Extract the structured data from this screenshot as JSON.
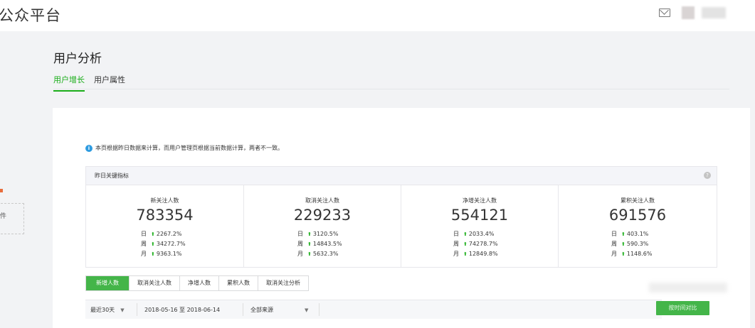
{
  "header": {
    "brand": "公众平台",
    "icons": {
      "mail": "mail-icon"
    }
  },
  "sidebar": {
    "item_fragment": "件"
  },
  "page": {
    "title": "用户分析",
    "tabs": [
      {
        "label": "用户增长",
        "active": true
      },
      {
        "label": "用户属性",
        "active": false
      }
    ]
  },
  "notice": {
    "icon": "info-icon",
    "text": "本页根据昨日数据来计算，而用户管理页根据当前数据计算，两者不一致。"
  },
  "kpi_panel": {
    "title": "昨日关键指标",
    "help_icon": "question-icon",
    "metrics": [
      {
        "label": "新关注人数",
        "value": "783354",
        "rows": [
          {
            "k": "日",
            "v": "2267.2%"
          },
          {
            "k": "周",
            "v": "34272.7%"
          },
          {
            "k": "月",
            "v": "9363.1%"
          }
        ]
      },
      {
        "label": "取消关注人数",
        "value": "229233",
        "rows": [
          {
            "k": "日",
            "v": "3120.5%"
          },
          {
            "k": "周",
            "v": "14843.5%"
          },
          {
            "k": "月",
            "v": "5632.3%"
          }
        ]
      },
      {
        "label": "净增关注人数",
        "value": "554121",
        "rows": [
          {
            "k": "日",
            "v": "2033.4%"
          },
          {
            "k": "周",
            "v": "74278.7%"
          },
          {
            "k": "月",
            "v": "12849.8%"
          }
        ]
      },
      {
        "label": "累积关注人数",
        "value": "691576",
        "rows": [
          {
            "k": "日",
            "v": "403.1%"
          },
          {
            "k": "周",
            "v": "590.3%"
          },
          {
            "k": "月",
            "v": "1148.6%"
          }
        ]
      }
    ]
  },
  "chart_tabs": [
    {
      "label": "新增人数",
      "active": true
    },
    {
      "label": "取消关注人数",
      "active": false
    },
    {
      "label": "净增人数",
      "active": false
    },
    {
      "label": "累积人数",
      "active": false
    },
    {
      "label": "取消关注分析",
      "active": false
    }
  ],
  "filters": {
    "period": "最近30天",
    "date_range": "2018-05-16 至 2018-06-14",
    "source": "全部来源"
  },
  "compare_button": "按时间对比",
  "colors": {
    "accent": "#1aad19",
    "button": "#44b549",
    "info": "#2e9be0"
  }
}
